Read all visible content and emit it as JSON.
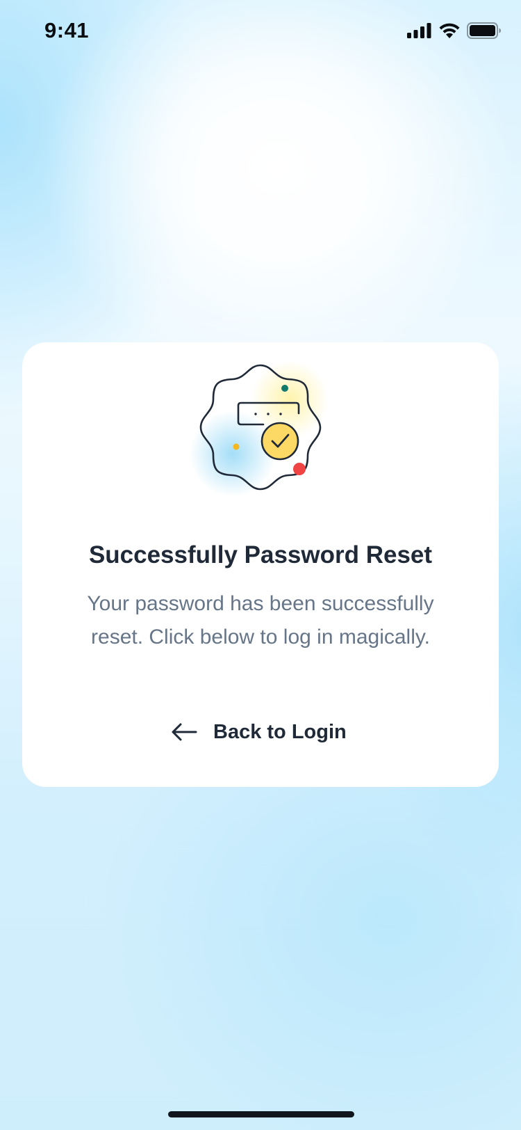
{
  "status_bar": {
    "time": "9:41",
    "icons": [
      "cellular-signal-icon",
      "wifi-icon",
      "battery-icon"
    ]
  },
  "card": {
    "illustration_icon": "password-reset-success-badge-icon",
    "title": "Successfully Password Reset",
    "description": "Your password has been successfully reset. Click below to log in magically.",
    "back_button": {
      "icon": "arrow-left-icon",
      "label": "Back to Login"
    }
  },
  "colors": {
    "card_background": "#ffffff",
    "title_text": "#1f2937",
    "body_text": "#667587",
    "badge_check_fill": "#fcd964",
    "accent_red": "#f04444",
    "accent_green": "#0f7a6b",
    "accent_yellow": "#f5b820"
  }
}
